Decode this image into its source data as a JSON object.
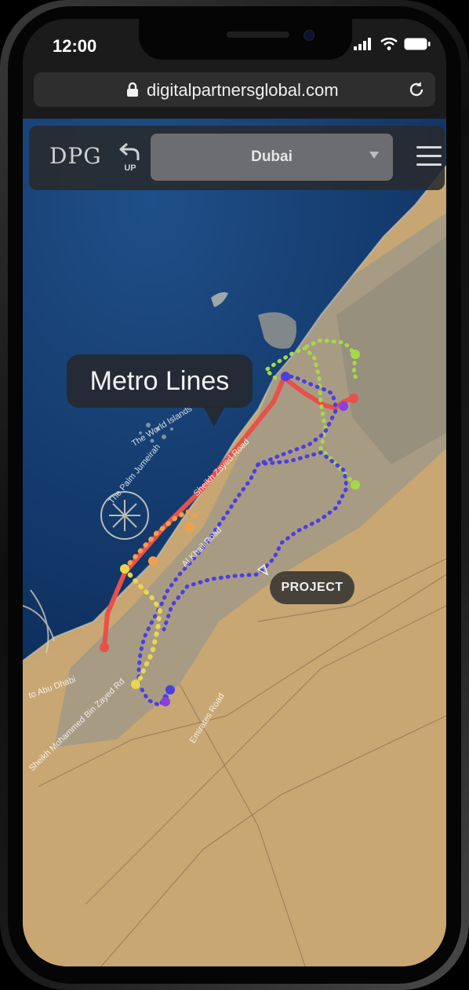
{
  "status_bar": {
    "time": "12:00"
  },
  "browser": {
    "url": "digitalpartnersglobal.com"
  },
  "header": {
    "logo": "DPG",
    "up_label": "UP",
    "city_selected": "Dubai"
  },
  "map": {
    "callout_title": "Metro Lines",
    "project_button": "PROJECT",
    "place_labels": {
      "world_islands": "The World Islands",
      "palm": "The Palm Jumeirah",
      "szr": "Sheikh Zayed Road",
      "al_khail": "Al Khail Road",
      "abu_dhabi": "to Abu Dhabi",
      "mbz": "Sheikh Mohammed Bin Zayed Rd",
      "emirates": "Emirates Road"
    },
    "line_colors": {
      "red": "#e8504a",
      "green": "#a6d94a",
      "blue": "#4a3fe0",
      "yellow": "#e9d650",
      "orange": "#f0a04a",
      "purple": "#8a3fe0"
    }
  }
}
